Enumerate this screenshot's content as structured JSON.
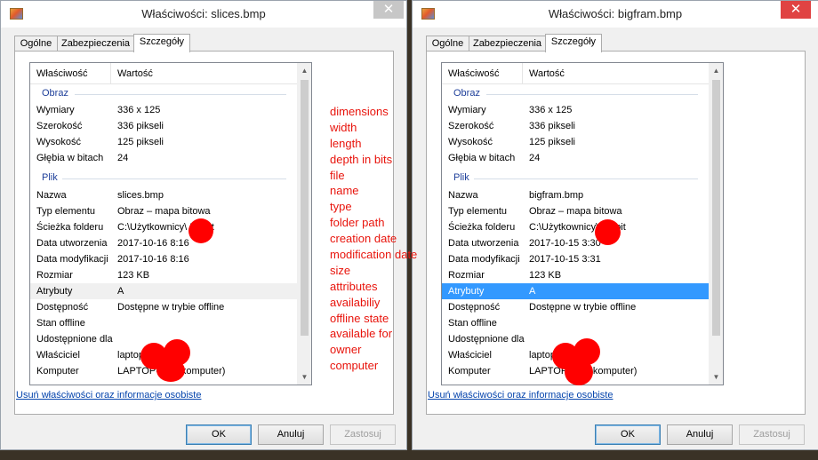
{
  "left": {
    "title": "Właściwości: slices.bmp",
    "tabs": [
      {
        "label": "Ogólne"
      },
      {
        "label": "Zabezpieczenia"
      },
      {
        "label": "Szczegóły"
      }
    ],
    "columns": {
      "name": "Właściwość",
      "value": "Wartość"
    },
    "groups": {
      "image": "Obraz",
      "file": "Plik"
    },
    "rows": [
      {
        "name": "Wymiary",
        "value": "336 x 125"
      },
      {
        "name": "Szerokość",
        "value": "336 pikseli"
      },
      {
        "name": "Wysokość",
        "value": "125 pikseli"
      },
      {
        "name": "Głębia w bitach",
        "value": "24"
      },
      {
        "name": "Nazwa",
        "value": "slices.bmp"
      },
      {
        "name": "Typ elementu",
        "value": "Obraz – mapa bitowa"
      },
      {
        "name": "Ścieżka folderu",
        "value": "C:\\Użytkownicy\\     Pulpit"
      },
      {
        "name": "Data utworzenia",
        "value": "2017-10-16 8:16"
      },
      {
        "name": "Data modyfikacji",
        "value": "2017-10-16 8:16"
      },
      {
        "name": "Rozmiar",
        "value": "123 KB"
      },
      {
        "name": "Atrybuty",
        "value": "A"
      },
      {
        "name": "Dostępność",
        "value": "Dostępne w trybie offline"
      },
      {
        "name": "Stan offline",
        "value": ""
      },
      {
        "name": "Udostępnione dla",
        "value": ""
      },
      {
        "name": "Właściciel",
        "value": "laptop"
      },
      {
        "name": "Komputer",
        "value": "LAPTOP-     (ten komputer)"
      }
    ],
    "remove_link": "Usuń właściwości oraz informacje osobiste",
    "buttons": {
      "ok": "OK",
      "cancel": "Anuluj",
      "apply": "Zastosuj"
    }
  },
  "right": {
    "title": "Właściwości: bigfram.bmp",
    "tabs": [
      {
        "label": "Ogólne"
      },
      {
        "label": "Zabezpieczenia"
      },
      {
        "label": "Szczegóły"
      }
    ],
    "columns": {
      "name": "Właściwość",
      "value": "Wartość"
    },
    "groups": {
      "image": "Obraz",
      "file": "Plik"
    },
    "rows": [
      {
        "name": "Wymiary",
        "value": "336 x 125"
      },
      {
        "name": "Szerokość",
        "value": "336 pikseli"
      },
      {
        "name": "Wysokość",
        "value": "125 pikseli"
      },
      {
        "name": "Głębia w bitach",
        "value": "24"
      },
      {
        "name": "Nazwa",
        "value": "bigfram.bmp"
      },
      {
        "name": "Typ elementu",
        "value": "Obraz – mapa bitowa"
      },
      {
        "name": "Ścieżka folderu",
        "value": "C:\\Użytkownicy\\     Pulpit"
      },
      {
        "name": "Data utworzenia",
        "value": "2017-10-15 3:30"
      },
      {
        "name": "Data modyfikacji",
        "value": "2017-10-15 3:31"
      },
      {
        "name": "Rozmiar",
        "value": "123 KB"
      },
      {
        "name": "Atrybuty",
        "value": "A"
      },
      {
        "name": "Dostępność",
        "value": "Dostępne w trybie offline"
      },
      {
        "name": "Stan offline",
        "value": ""
      },
      {
        "name": "Udostępnione dla",
        "value": ""
      },
      {
        "name": "Właściciel",
        "value": "laptop-"
      },
      {
        "name": "Komputer",
        "value": "LAPTOP-     (ten komputer)"
      }
    ],
    "remove_link": "Usuń właściwości oraz informacje osobiste",
    "buttons": {
      "ok": "OK",
      "cancel": "Anuluj",
      "apply": "Zastosuj"
    }
  },
  "annotations": [
    "dimensions",
    "width",
    "length",
    "depth in bits",
    "file",
    "name",
    "type",
    "folder path",
    "creation date",
    "modification date",
    "size",
    "attributes",
    "availabiliy",
    "offline state",
    "available for",
    "owner",
    "computer"
  ],
  "colors": {
    "annotation": "#e8140c",
    "redaction": "#ff0000",
    "selection": "#3399ff",
    "group_label": "#1e3f9a",
    "link": "#0645ad"
  },
  "icons": {
    "title": "bitmap-file-icon",
    "close": "close-icon"
  }
}
